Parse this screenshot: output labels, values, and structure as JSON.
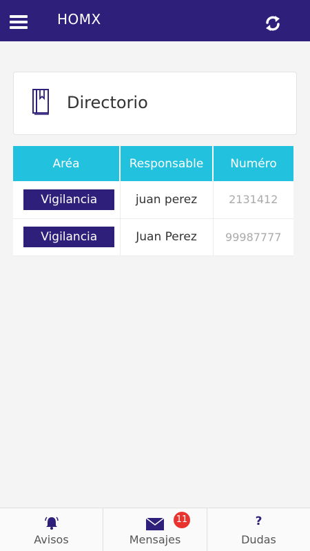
{
  "header": {
    "title": "HOMX"
  },
  "card": {
    "title": "Directorio"
  },
  "table": {
    "columns": [
      "Aréa",
      "Responsable",
      "Numéro"
    ],
    "rows": [
      {
        "area": "Vigilancia",
        "responsable": "juan perez",
        "numero": "2131412"
      },
      {
        "area": "Vigilancia",
        "responsable": "Juan Perez",
        "numero": "99987777"
      }
    ]
  },
  "bottom_nav": {
    "items": [
      {
        "label": "Avisos",
        "icon": "bell-icon"
      },
      {
        "label": "Mensajes",
        "icon": "envelope-icon",
        "badge": "11"
      },
      {
        "label": "Dudas",
        "icon": "question-icon"
      }
    ]
  },
  "colors": {
    "primary": "#2e1f7a",
    "accent": "#22c1dd",
    "badge": "#e8332f"
  }
}
